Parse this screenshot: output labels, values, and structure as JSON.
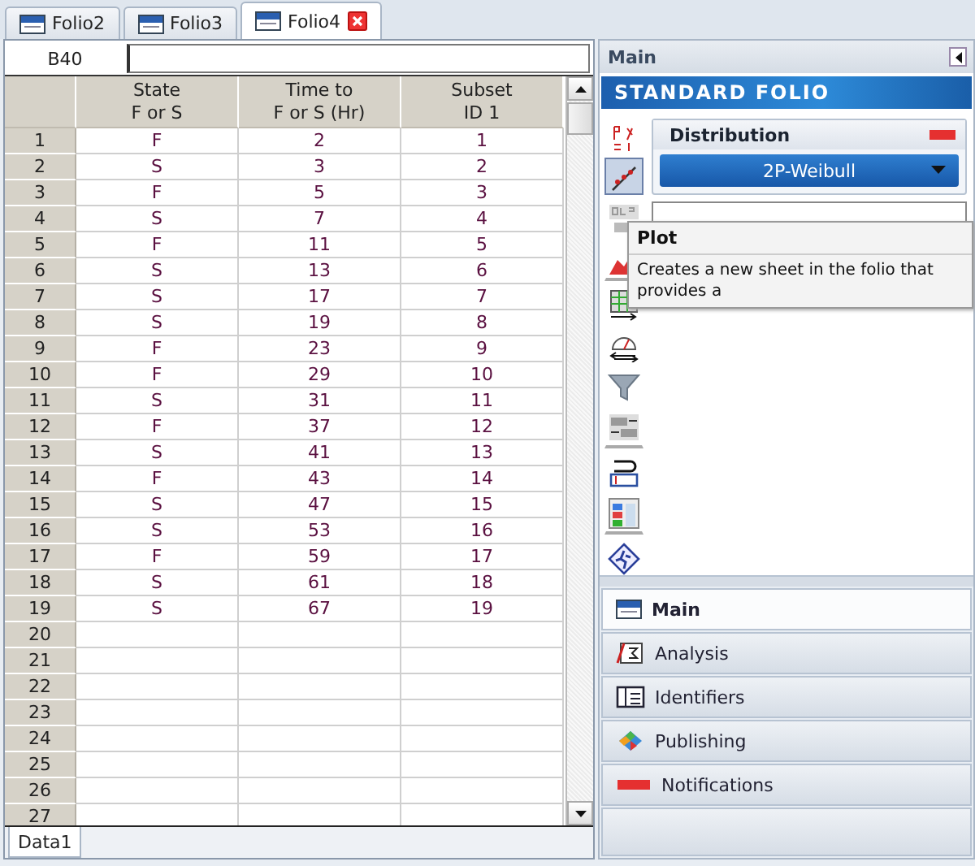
{
  "tabs": [
    {
      "label": "Folio2",
      "selected": false,
      "closable": false
    },
    {
      "label": "Folio3",
      "selected": false,
      "closable": false
    },
    {
      "label": "Folio4",
      "selected": true,
      "closable": true
    }
  ],
  "name_box": {
    "value": "B40"
  },
  "sheet": {
    "columns": [
      {
        "line1": "State",
        "line2": "F or S"
      },
      {
        "line1": "Time to",
        "line2": "F or S (Hr)"
      },
      {
        "line1": "Subset",
        "line2": "ID 1"
      }
    ],
    "rows": [
      {
        "number": "1",
        "cells": [
          "F",
          "2",
          "1"
        ]
      },
      {
        "number": "2",
        "cells": [
          "S",
          "3",
          "2"
        ]
      },
      {
        "number": "3",
        "cells": [
          "F",
          "5",
          "3"
        ]
      },
      {
        "number": "4",
        "cells": [
          "S",
          "7",
          "4"
        ]
      },
      {
        "number": "5",
        "cells": [
          "F",
          "11",
          "5"
        ]
      },
      {
        "number": "6",
        "cells": [
          "S",
          "13",
          "6"
        ]
      },
      {
        "number": "7",
        "cells": [
          "S",
          "17",
          "7"
        ]
      },
      {
        "number": "8",
        "cells": [
          "S",
          "19",
          "8"
        ]
      },
      {
        "number": "9",
        "cells": [
          "F",
          "23",
          "9"
        ]
      },
      {
        "number": "10",
        "cells": [
          "F",
          "29",
          "10"
        ]
      },
      {
        "number": "11",
        "cells": [
          "S",
          "31",
          "11"
        ]
      },
      {
        "number": "12",
        "cells": [
          "F",
          "37",
          "12"
        ]
      },
      {
        "number": "13",
        "cells": [
          "S",
          "41",
          "13"
        ]
      },
      {
        "number": "14",
        "cells": [
          "F",
          "43",
          "14"
        ]
      },
      {
        "number": "15",
        "cells": [
          "S",
          "47",
          "15"
        ]
      },
      {
        "number": "16",
        "cells": [
          "S",
          "53",
          "16"
        ]
      },
      {
        "number": "17",
        "cells": [
          "F",
          "59",
          "17"
        ]
      },
      {
        "number": "18",
        "cells": [
          "S",
          "61",
          "18"
        ]
      },
      {
        "number": "19",
        "cells": [
          "S",
          "67",
          "19"
        ]
      },
      {
        "number": "20",
        "cells": []
      },
      {
        "number": "21",
        "cells": []
      },
      {
        "number": "22",
        "cells": []
      },
      {
        "number": "23",
        "cells": []
      },
      {
        "number": "24",
        "cells": []
      },
      {
        "number": "25",
        "cells": []
      },
      {
        "number": "26",
        "cells": []
      },
      {
        "number": "27",
        "cells": []
      }
    ]
  },
  "sheet_tabs": [
    {
      "label": "Data1",
      "selected": true
    }
  ],
  "panel": {
    "title": "Main",
    "banner": "STANDARD FOLIO"
  },
  "tool_icons": [
    {
      "kind": "parameters",
      "selected": false,
      "separator_after": false
    },
    {
      "kind": "plot",
      "selected": true,
      "separator_after": false
    },
    {
      "kind": "qcp",
      "selected": false,
      "separator_after": false
    },
    {
      "kind": "chart",
      "selected": false,
      "separator_after": true
    },
    {
      "kind": "table",
      "selected": false,
      "separator_after": false
    },
    {
      "kind": "gauge",
      "selected": false,
      "separator_after": false
    },
    {
      "kind": "filter",
      "selected": false,
      "separator_after": false
    },
    {
      "kind": "convert",
      "selected": false,
      "separator_after": true
    },
    {
      "kind": "link",
      "selected": false,
      "separator_after": false
    },
    {
      "kind": "grid",
      "selected": false,
      "separator_after": true
    },
    {
      "kind": "run",
      "selected": false,
      "separator_after": false
    }
  ],
  "distribution": {
    "title": "Distribution",
    "value": "2P-Weibull"
  },
  "tooltip": {
    "title": "Plot",
    "text": "Creates a new sheet in the folio that provides a"
  },
  "nav": [
    {
      "label": "Main",
      "kind": "folio",
      "selected": true
    },
    {
      "label": "Analysis",
      "kind": "analysis",
      "selected": false
    },
    {
      "label": "Identifiers",
      "kind": "identifiers",
      "selected": false
    },
    {
      "label": "Publishing",
      "kind": "publishing",
      "selected": false
    },
    {
      "label": "Notifications",
      "kind": "notifications",
      "selected": false
    }
  ]
}
